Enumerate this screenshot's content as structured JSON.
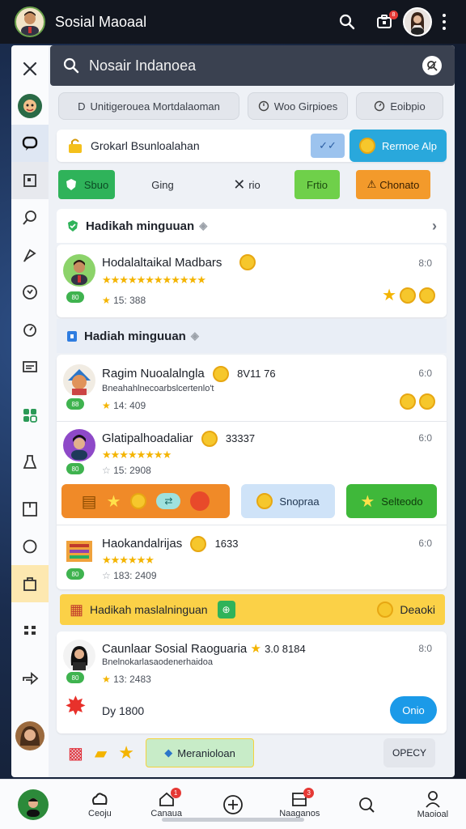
{
  "app": {
    "title": "Sosial Maoaal",
    "notification_count": "8"
  },
  "search": {
    "value": "Nosair Indanoea"
  },
  "filters": [
    {
      "label": "Unitigerouea Mortdalaoman"
    },
    {
      "label": "Woo Girpioes"
    },
    {
      "label": "Eoibpio"
    }
  ],
  "cta": {
    "text": "Grokarl Bsunloalahan",
    "check_label": "✓✓",
    "button_label": "Rermoe Alp"
  },
  "buttons": {
    "sbuo": "Sbuo",
    "ging": "Ging",
    "rio": "rio",
    "frtio": "Frtio",
    "chonato": "Chonato"
  },
  "section1": {
    "title": "Hadikah minguuan"
  },
  "item1": {
    "title": "Hodalaltaikal Madbars",
    "stars": "★★★★★★★★★★★★",
    "meta": "15: 388",
    "time": "8:0",
    "badge": "80"
  },
  "section2": {
    "title": "Hadiah minguuan"
  },
  "item2": {
    "title": "Ragim Nuoalalngla",
    "score": "8V11 76",
    "sub": "Bneahahlnecoarbslcertenlo't",
    "meta": "14: 409",
    "time": "6:0",
    "badge": "88"
  },
  "item3": {
    "title": "Glatipalhoadaliar",
    "score": "33337",
    "stars": "★★★★★★★★",
    "meta": "15: 2908",
    "time": "6:0",
    "badge": "80"
  },
  "actions": {
    "snopraa": "Snopraa",
    "selteodo": "Selteodo"
  },
  "item4": {
    "title": "Haokandalrijas",
    "score": "1633",
    "stars": "★★★★★★",
    "meta": "183: 2409",
    "time": "6:0",
    "badge": "80"
  },
  "banner": {
    "text": "Hadikah maslalninguan",
    "right_label": "Deaoki"
  },
  "item5": {
    "title": "Caunlaar Sosial Raoguaria",
    "score": "3.0 8184",
    "sub": "Bnelnokarlasaodenerhaidoa",
    "meta": "13: 2483",
    "time": "8:0",
    "badge": "80",
    "extra": "Dy 1800",
    "button_label": "Onio"
  },
  "bottom_strip": {
    "chip_label": "Meranioloan",
    "button_label": "OPECY"
  },
  "nav": [
    {
      "label": "Ceoju",
      "badge": ""
    },
    {
      "label": "Canaua",
      "badge": "1"
    },
    {
      "label": "",
      "badge": ""
    },
    {
      "label": "Naaganos",
      "badge": "3"
    },
    {
      "label": "",
      "badge": ""
    },
    {
      "label": "Maoioal",
      "badge": ""
    }
  ],
  "colors": {
    "accent_blue": "#29a8dc",
    "green": "#3fb34f",
    "orange": "#f39a2b",
    "gold": "#fbd147",
    "topbar": "#12161f"
  }
}
